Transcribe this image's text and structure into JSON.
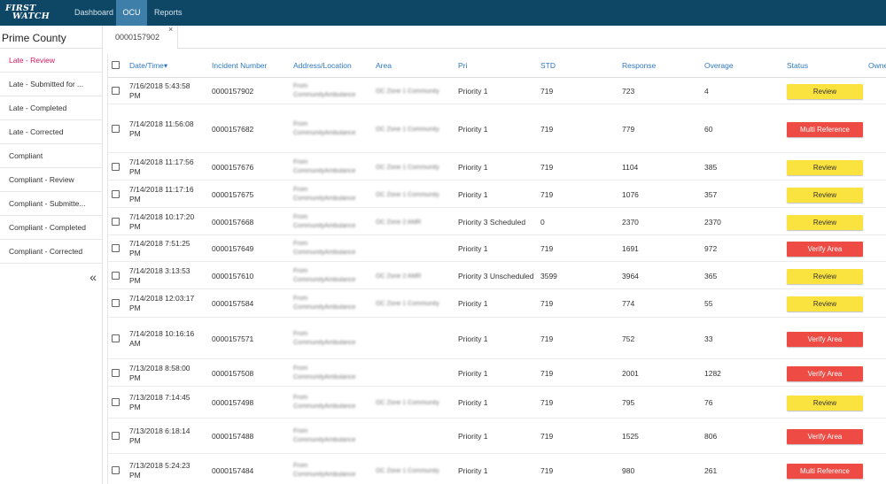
{
  "logo": {
    "line1": "FIRST",
    "line2": "WATCH"
  },
  "nav": {
    "tabs": [
      "Dashboard",
      "OCU",
      "Reports"
    ],
    "active": "OCU"
  },
  "sidebar": {
    "title": "Prime County",
    "items": [
      "Late - Review",
      "Late - Submitted for ...",
      "Late - Completed",
      "Late - Corrected",
      "Compliant",
      "Compliant - Review",
      "Compliant - Submitte...",
      "Compliant - Completed",
      "Compliant - Corrected"
    ],
    "active": "Late - Review",
    "collapse_glyph": "«"
  },
  "doc_tab": {
    "label": "0000157902",
    "close_glyph": "×"
  },
  "table": {
    "columns": {
      "date": "Date/Time",
      "incident": "Incident Number",
      "address": "Address/Location",
      "area": "Area",
      "pri": "Pri",
      "std": "STD",
      "response": "Response",
      "overage": "Overage",
      "status": "Status",
      "owner": "Owne"
    },
    "sort_indicator": "▾",
    "blurred_address_text": {
      "line1": "From",
      "line2": "CommunityAmbulance"
    },
    "blurred_area_text": "OC Zone 1 Community",
    "rows": [
      {
        "date": "7/16/2018 5:43:58 PM",
        "incident": "0000157902",
        "area": "OC Zone 1 Community",
        "pri": "Priority 1",
        "std": "719",
        "response": "723",
        "overage": "4",
        "status": "Review"
      },
      {
        "date": "7/14/2018 11:56:08 PM",
        "incident": "0000157682",
        "area": "OC Zone 1 Community",
        "pri": "Priority 1",
        "std": "719",
        "response": "779",
        "overage": "60",
        "status": "Multi Reference"
      },
      {
        "date": "7/14/2018 11:17:56 PM",
        "incident": "0000157676",
        "area": "OC Zone 1 Community",
        "pri": "Priority 1",
        "std": "719",
        "response": "1104",
        "overage": "385",
        "status": "Review"
      },
      {
        "date": "7/14/2018 11:17:16 PM",
        "incident": "0000157675",
        "area": "OC Zone 1 Community",
        "pri": "Priority 1",
        "std": "719",
        "response": "1076",
        "overage": "357",
        "status": "Review"
      },
      {
        "date": "7/14/2018 10:17:20 PM",
        "incident": "0000157668",
        "area": "OC Zone 2 AMR",
        "pri": "Priority 3 Scheduled",
        "std": "0",
        "response": "2370",
        "overage": "2370",
        "status": "Review"
      },
      {
        "date": "7/14/2018 7:51:25 PM",
        "incident": "0000157649",
        "area": "",
        "pri": "Priority 1",
        "std": "719",
        "response": "1691",
        "overage": "972",
        "status": "Verify Area"
      },
      {
        "date": "7/14/2018 3:13:53 PM",
        "incident": "0000157610",
        "area": "OC Zone 2 AMR",
        "pri": "Priority 3 Unscheduled",
        "std": "3599",
        "response": "3964",
        "overage": "365",
        "status": "Review"
      },
      {
        "date": "7/14/2018 12:03:17 PM",
        "incident": "0000157584",
        "area": "OC Zone 1 Community",
        "pri": "Priority 1",
        "std": "719",
        "response": "774",
        "overage": "55",
        "status": "Review"
      },
      {
        "date": "7/14/2018 10:16:16 AM",
        "incident": "0000157571",
        "area": "",
        "pri": "Priority 1",
        "std": "719",
        "response": "752",
        "overage": "33",
        "status": "Verify Area"
      },
      {
        "date": "7/13/2018 8:58:00 PM",
        "incident": "0000157508",
        "area": "",
        "pri": "Priority 1",
        "std": "719",
        "response": "2001",
        "overage": "1282",
        "status": "Verify Area"
      },
      {
        "date": "7/13/2018 7:14:45 PM",
        "incident": "0000157498",
        "area": "OC Zone 1 Community",
        "pri": "Priority 1",
        "std": "719",
        "response": "795",
        "overage": "76",
        "status": "Review"
      },
      {
        "date": "7/13/2018 6:18:14 PM",
        "incident": "0000157488",
        "area": "",
        "pri": "Priority 1",
        "std": "719",
        "response": "1525",
        "overage": "806",
        "status": "Verify Area"
      },
      {
        "date": "7/13/2018 5:24:23 PM",
        "incident": "0000157484",
        "area": "OC Zone 1 Community",
        "pri": "Priority 1",
        "std": "719",
        "response": "980",
        "overage": "261",
        "status": "Multi Reference"
      }
    ]
  },
  "colors": {
    "nav_bg": "#0e4766",
    "nav_active": "#3d7fa8",
    "accent_link": "#2f79c2",
    "active_sidebar": "#d81b60",
    "review": "#fbe33f",
    "alert": "#ee4b44"
  }
}
